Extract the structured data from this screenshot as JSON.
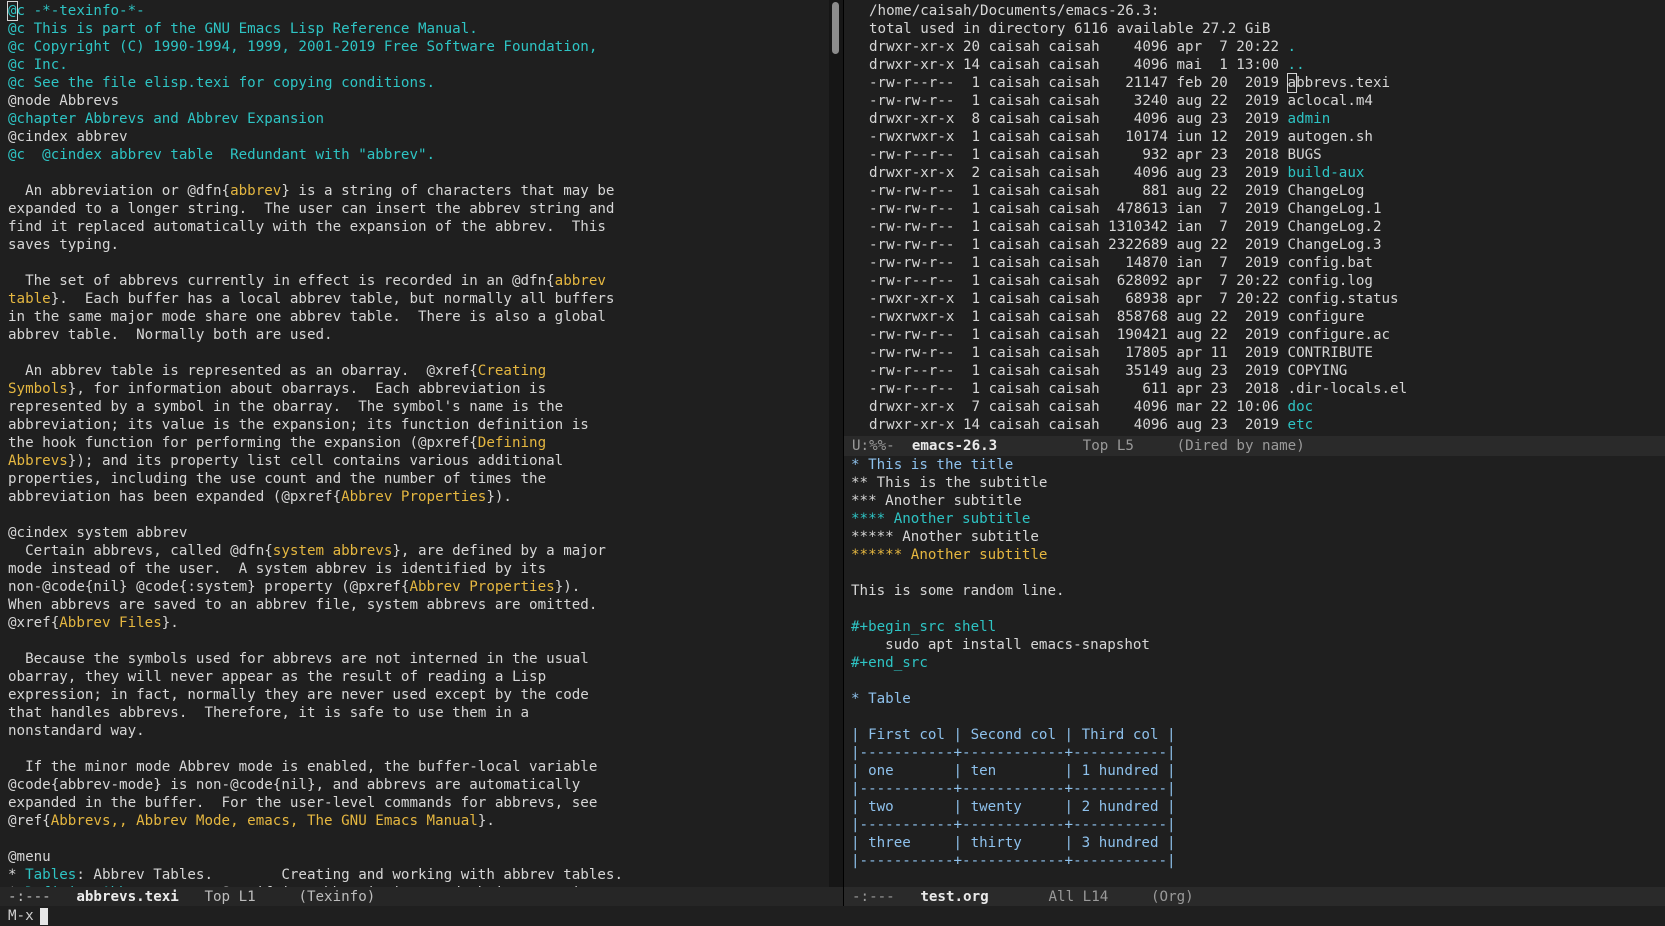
{
  "left_pane": {
    "lines": [
      [
        [
          "@c -*-texinfo-*-",
          "cmt"
        ]
      ],
      [
        [
          "@c This is part of the GNU Emacs Lisp Reference Manual.",
          "cmt"
        ]
      ],
      [
        [
          "@c Copyright (C) 1990-1994, 1999, 2001-2019 Free Software Foundation,",
          "cmt"
        ]
      ],
      [
        [
          "@c Inc.",
          "cmt"
        ]
      ],
      [
        [
          "@c See the file elisp.texi for copying conditions.",
          "cmt"
        ]
      ],
      [
        [
          "@node Abbrevs",
          ""
        ]
      ],
      [
        [
          "@chapter Abbrevs and Abbrev Expansion",
          "cmt"
        ]
      ],
      [
        [
          "@cindex abbrev",
          ""
        ]
      ],
      [
        [
          "@c  @cindex abbrev table  Redundant with \"abbrev\".",
          "cmt"
        ]
      ],
      [
        [
          "",
          ""
        ]
      ],
      [
        [
          "  An abbreviation or @dfn{",
          ""
        ],
        [
          "abbrev",
          "yel"
        ],
        [
          "} is a string of characters that may be",
          ""
        ]
      ],
      [
        [
          "expanded to a longer string.  The user can insert the abbrev string and",
          ""
        ]
      ],
      [
        [
          "find it replaced automatically with the expansion of the abbrev.  This",
          ""
        ]
      ],
      [
        [
          "saves typing.",
          ""
        ]
      ],
      [
        [
          "",
          ""
        ]
      ],
      [
        [
          "  The set of abbrevs currently in effect is recorded in an @dfn{",
          ""
        ],
        [
          "abbrev",
          "yel"
        ]
      ],
      [
        [
          "table",
          "yel"
        ],
        [
          "}.  Each buffer has a local abbrev table, but normally all buffers",
          ""
        ]
      ],
      [
        [
          "in the same major mode share one abbrev table.  There is also a global",
          ""
        ]
      ],
      [
        [
          "abbrev table.  Normally both are used.",
          ""
        ]
      ],
      [
        [
          "",
          ""
        ]
      ],
      [
        [
          "  An abbrev table is represented as an obarray.  @xref{",
          ""
        ],
        [
          "Creating",
          "yel"
        ]
      ],
      [
        [
          "Symbols",
          "yel"
        ],
        [
          "}, for information about obarrays.  Each abbreviation is",
          ""
        ]
      ],
      [
        [
          "represented by a symbol in the obarray.  The symbol's name is the",
          ""
        ]
      ],
      [
        [
          "abbreviation; its value is the expansion; its function definition is",
          ""
        ]
      ],
      [
        [
          "the hook function for performing the expansion (@pxref{",
          ""
        ],
        [
          "Defining",
          "yel"
        ]
      ],
      [
        [
          "Abbrevs",
          "yel"
        ],
        [
          "}); and its property list cell contains various additional",
          ""
        ]
      ],
      [
        [
          "properties, including the use count and the number of times the",
          ""
        ]
      ],
      [
        [
          "abbreviation has been expanded (@pxref{",
          ""
        ],
        [
          "Abbrev Properties",
          "yel"
        ],
        [
          "}).",
          ""
        ]
      ],
      [
        [
          "",
          ""
        ]
      ],
      [
        [
          "@cindex system abbrev",
          ""
        ]
      ],
      [
        [
          "  Certain abbrevs, called @dfn{",
          ""
        ],
        [
          "system abbrevs",
          "yel"
        ],
        [
          "}, are defined by a major",
          ""
        ]
      ],
      [
        [
          "mode instead of the user.  A system abbrev is identified by its",
          ""
        ]
      ],
      [
        [
          "non-@code{nil} @code{:system} property (@pxref{",
          ""
        ],
        [
          "Abbrev Properties",
          "yel"
        ],
        [
          "}).",
          ""
        ]
      ],
      [
        [
          "When abbrevs are saved to an abbrev file, system abbrevs are omitted.",
          ""
        ]
      ],
      [
        [
          "@xref{",
          ""
        ],
        [
          "Abbrev Files",
          "yel"
        ],
        [
          "}.",
          ""
        ]
      ],
      [
        [
          "",
          ""
        ]
      ],
      [
        [
          "  Because the symbols used for abbrevs are not interned in the usual",
          ""
        ]
      ],
      [
        [
          "obarray, they will never appear as the result of reading a Lisp",
          ""
        ]
      ],
      [
        [
          "expression; in fact, normally they are never used except by the code",
          ""
        ]
      ],
      [
        [
          "that handles abbrevs.  Therefore, it is safe to use them in a",
          ""
        ]
      ],
      [
        [
          "nonstandard way.",
          ""
        ]
      ],
      [
        [
          "",
          ""
        ]
      ],
      [
        [
          "  If the minor mode Abbrev mode is enabled, the buffer-local variable",
          ""
        ]
      ],
      [
        [
          "@code{abbrev-mode} is non-@code{nil}, and abbrevs are automatically",
          ""
        ]
      ],
      [
        [
          "expanded in the buffer.  For the user-level commands for abbrevs, see",
          ""
        ]
      ],
      [
        [
          "@ref{",
          ""
        ],
        [
          "Abbrevs,, Abbrev Mode, emacs, The GNU Emacs Manual",
          "yel"
        ],
        [
          "}.",
          ""
        ]
      ],
      [
        [
          "",
          ""
        ]
      ],
      [
        [
          "@menu",
          ""
        ]
      ],
      [
        [
          "* ",
          ""
        ],
        [
          "Tables",
          "cyn"
        ],
        [
          ": Abbrev Tables.        Creating and working with abbrev tables.",
          ""
        ]
      ],
      [
        [
          "* ",
          ""
        ],
        [
          "Defining Abbrevs",
          "cyn"
        ],
        [
          "::     Specifying abbreviations and their expansions.",
          ""
        ]
      ]
    ],
    "modeline": {
      "flags": "-:---",
      "buffer": "abbrevs.texi",
      "position": "Top L1",
      "mode": "(Texinfo)"
    }
  },
  "dired": {
    "header": "/home/caisah/Documents/emacs-26.3:",
    "total": "total used in directory 6116 available 27.2 GiB",
    "rows": [
      {
        "perm": "drwxr-xr-x",
        "links": "20",
        "owner": "caisah",
        "group": "caisah",
        "size": "4096",
        "date": "apr  7 20:22",
        "name": ".",
        "dir": true
      },
      {
        "perm": "drwxr-xr-x",
        "links": "14",
        "owner": "caisah",
        "group": "caisah",
        "size": "4096",
        "date": "mai  1 13:00",
        "name": "..",
        "dir": true
      },
      {
        "perm": "-rw-r--r--",
        "links": "1",
        "owner": "caisah",
        "group": "caisah",
        "size": "21147",
        "date": "feb 20  2019",
        "name": "abbrevs.texi",
        "dir": false
      },
      {
        "perm": "-rw-rw-r--",
        "links": "1",
        "owner": "caisah",
        "group": "caisah",
        "size": "3240",
        "date": "aug 22  2019",
        "name": "aclocal.m4",
        "dir": false
      },
      {
        "perm": "drwxr-xr-x",
        "links": "8",
        "owner": "caisah",
        "group": "caisah",
        "size": "4096",
        "date": "aug 23  2019",
        "name": "admin",
        "dir": true
      },
      {
        "perm": "-rwxrwxr-x",
        "links": "1",
        "owner": "caisah",
        "group": "caisah",
        "size": "10174",
        "date": "iun 12  2019",
        "name": "autogen.sh",
        "dir": false
      },
      {
        "perm": "-rw-r--r--",
        "links": "1",
        "owner": "caisah",
        "group": "caisah",
        "size": "932",
        "date": "apr 23  2018",
        "name": "BUGS",
        "dir": false
      },
      {
        "perm": "drwxr-xr-x",
        "links": "2",
        "owner": "caisah",
        "group": "caisah",
        "size": "4096",
        "date": "aug 23  2019",
        "name": "build-aux",
        "dir": true
      },
      {
        "perm": "-rw-rw-r--",
        "links": "1",
        "owner": "caisah",
        "group": "caisah",
        "size": "881",
        "date": "aug 22  2019",
        "name": "ChangeLog",
        "dir": false
      },
      {
        "perm": "-rw-rw-r--",
        "links": "1",
        "owner": "caisah",
        "group": "caisah",
        "size": "478613",
        "date": "ian  7  2019",
        "name": "ChangeLog.1",
        "dir": false
      },
      {
        "perm": "-rw-rw-r--",
        "links": "1",
        "owner": "caisah",
        "group": "caisah",
        "size": "1310342",
        "date": "ian  7  2019",
        "name": "ChangeLog.2",
        "dir": false
      },
      {
        "perm": "-rw-rw-r--",
        "links": "1",
        "owner": "caisah",
        "group": "caisah",
        "size": "2322689",
        "date": "aug 22  2019",
        "name": "ChangeLog.3",
        "dir": false
      },
      {
        "perm": "-rw-rw-r--",
        "links": "1",
        "owner": "caisah",
        "group": "caisah",
        "size": "14870",
        "date": "ian  7  2019",
        "name": "config.bat",
        "dir": false
      },
      {
        "perm": "-rw-r--r--",
        "links": "1",
        "owner": "caisah",
        "group": "caisah",
        "size": "628092",
        "date": "apr  7 20:22",
        "name": "config.log",
        "dir": false
      },
      {
        "perm": "-rwxr-xr-x",
        "links": "1",
        "owner": "caisah",
        "group": "caisah",
        "size": "68938",
        "date": "apr  7 20:22",
        "name": "config.status",
        "dir": false
      },
      {
        "perm": "-rwxrwxr-x",
        "links": "1",
        "owner": "caisah",
        "group": "caisah",
        "size": "858768",
        "date": "aug 22  2019",
        "name": "configure",
        "dir": false
      },
      {
        "perm": "-rw-rw-r--",
        "links": "1",
        "owner": "caisah",
        "group": "caisah",
        "size": "190421",
        "date": "aug 22  2019",
        "name": "configure.ac",
        "dir": false
      },
      {
        "perm": "-rw-rw-r--",
        "links": "1",
        "owner": "caisah",
        "group": "caisah",
        "size": "17805",
        "date": "apr 11  2019",
        "name": "CONTRIBUTE",
        "dir": false
      },
      {
        "perm": "-rw-r--r--",
        "links": "1",
        "owner": "caisah",
        "group": "caisah",
        "size": "35149",
        "date": "aug 23  2019",
        "name": "COPYING",
        "dir": false
      },
      {
        "perm": "-rw-r--r--",
        "links": "1",
        "owner": "caisah",
        "group": "caisah",
        "size": "611",
        "date": "apr 23  2018",
        "name": ".dir-locals.el",
        "dir": false
      },
      {
        "perm": "drwxr-xr-x",
        "links": "7",
        "owner": "caisah",
        "group": "caisah",
        "size": "4096",
        "date": "mar 22 10:06",
        "name": "doc",
        "dir": true
      },
      {
        "perm": "drwxr-xr-x",
        "links": "14",
        "owner": "caisah",
        "group": "caisah",
        "size": "4096",
        "date": "aug 23  2019",
        "name": "etc",
        "dir": true
      }
    ],
    "modeline": {
      "flags": "U:%%-",
      "buffer": "emacs-26.3",
      "position": "Top L5",
      "mode": "(Dired by name)"
    }
  },
  "org": {
    "lines": [
      [
        [
          "* This is the title",
          "blu"
        ]
      ],
      [
        [
          "** This is the subtitle",
          ""
        ]
      ],
      [
        [
          "*** Another subtitle",
          ""
        ]
      ],
      [
        [
          "**** Another subtitle",
          "cyn"
        ]
      ],
      [
        [
          "***** Another subtitle",
          ""
        ]
      ],
      [
        [
          "****** Another subtitle",
          "yel"
        ]
      ],
      [
        [
          "",
          ""
        ]
      ],
      [
        [
          "This is some random line.",
          ""
        ]
      ],
      [
        [
          "",
          ""
        ]
      ],
      [
        [
          "#+begin_src shell",
          "cyn"
        ]
      ],
      [
        [
          "    sudo apt install emacs-snapshot",
          ""
        ]
      ],
      [
        [
          "#+end_src",
          "cyn"
        ]
      ],
      [
        [
          "",
          ""
        ]
      ],
      [
        [
          "* Table",
          "blu"
        ]
      ],
      [
        [
          "",
          ""
        ]
      ],
      [
        [
          "| First col | Second col | Third col |",
          "blu"
        ]
      ],
      [
        [
          "|-----------+------------+-----------|",
          "blu"
        ]
      ],
      [
        [
          "| one       | ten        | 1 hundred |",
          "blu"
        ]
      ],
      [
        [
          "|-----------+------------+-----------|",
          "blu"
        ]
      ],
      [
        [
          "| two       | twenty     | 2 hundred |",
          "blu"
        ]
      ],
      [
        [
          "|-----------+------------+-----------|",
          "blu"
        ]
      ],
      [
        [
          "| three     | thirty     | 3 hundred |",
          "blu"
        ]
      ],
      [
        [
          "|-----------+------------+-----------|",
          "blu"
        ]
      ]
    ],
    "modeline": {
      "flags": "-:---",
      "buffer": "test.org",
      "position": "All L14",
      "mode": "(Org)"
    }
  },
  "minibuffer": {
    "prompt": "M-x"
  }
}
